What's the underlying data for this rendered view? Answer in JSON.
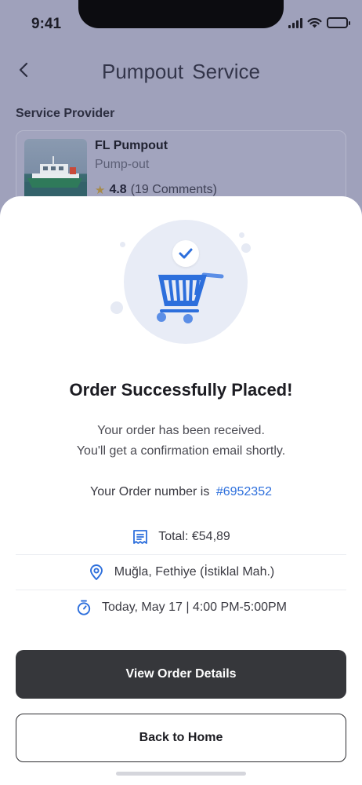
{
  "status_bar": {
    "time": "9:41"
  },
  "nav": {
    "title": "Pumpout Service"
  },
  "provider_section": {
    "label": "Service Provider",
    "card": {
      "name": "FL Pumpout",
      "type": "Pump-out",
      "rating": "4.8",
      "comments": "(19 Comments)"
    }
  },
  "confirmation": {
    "title": "Order Successfully Placed!",
    "message_line1": "Your order has been received.",
    "message_line2": "You'll get a confirmation email shortly.",
    "order_number_label": "Your Order number is",
    "order_number": "#6952352",
    "total": "Total: €54,89",
    "location": "Muğla, Fethiye (İstiklal Mah.)",
    "schedule": "Today, May 17 | 4:00 PM-5:00PM",
    "primary_button": "View Order Details",
    "secondary_button": "Back to Home"
  },
  "colors": {
    "accent": "#2d6fdc",
    "primary_button_bg": "#36373b",
    "overlay_bg": "#9fa1bb",
    "hero_circle": "#e8ecf6"
  },
  "icons": {
    "back": "chevron-left-icon",
    "star": "star-icon",
    "cart": "shopping-cart-icon",
    "check": "check-icon",
    "receipt": "receipt-icon",
    "location": "location-pin-icon",
    "time": "stopwatch-icon"
  }
}
